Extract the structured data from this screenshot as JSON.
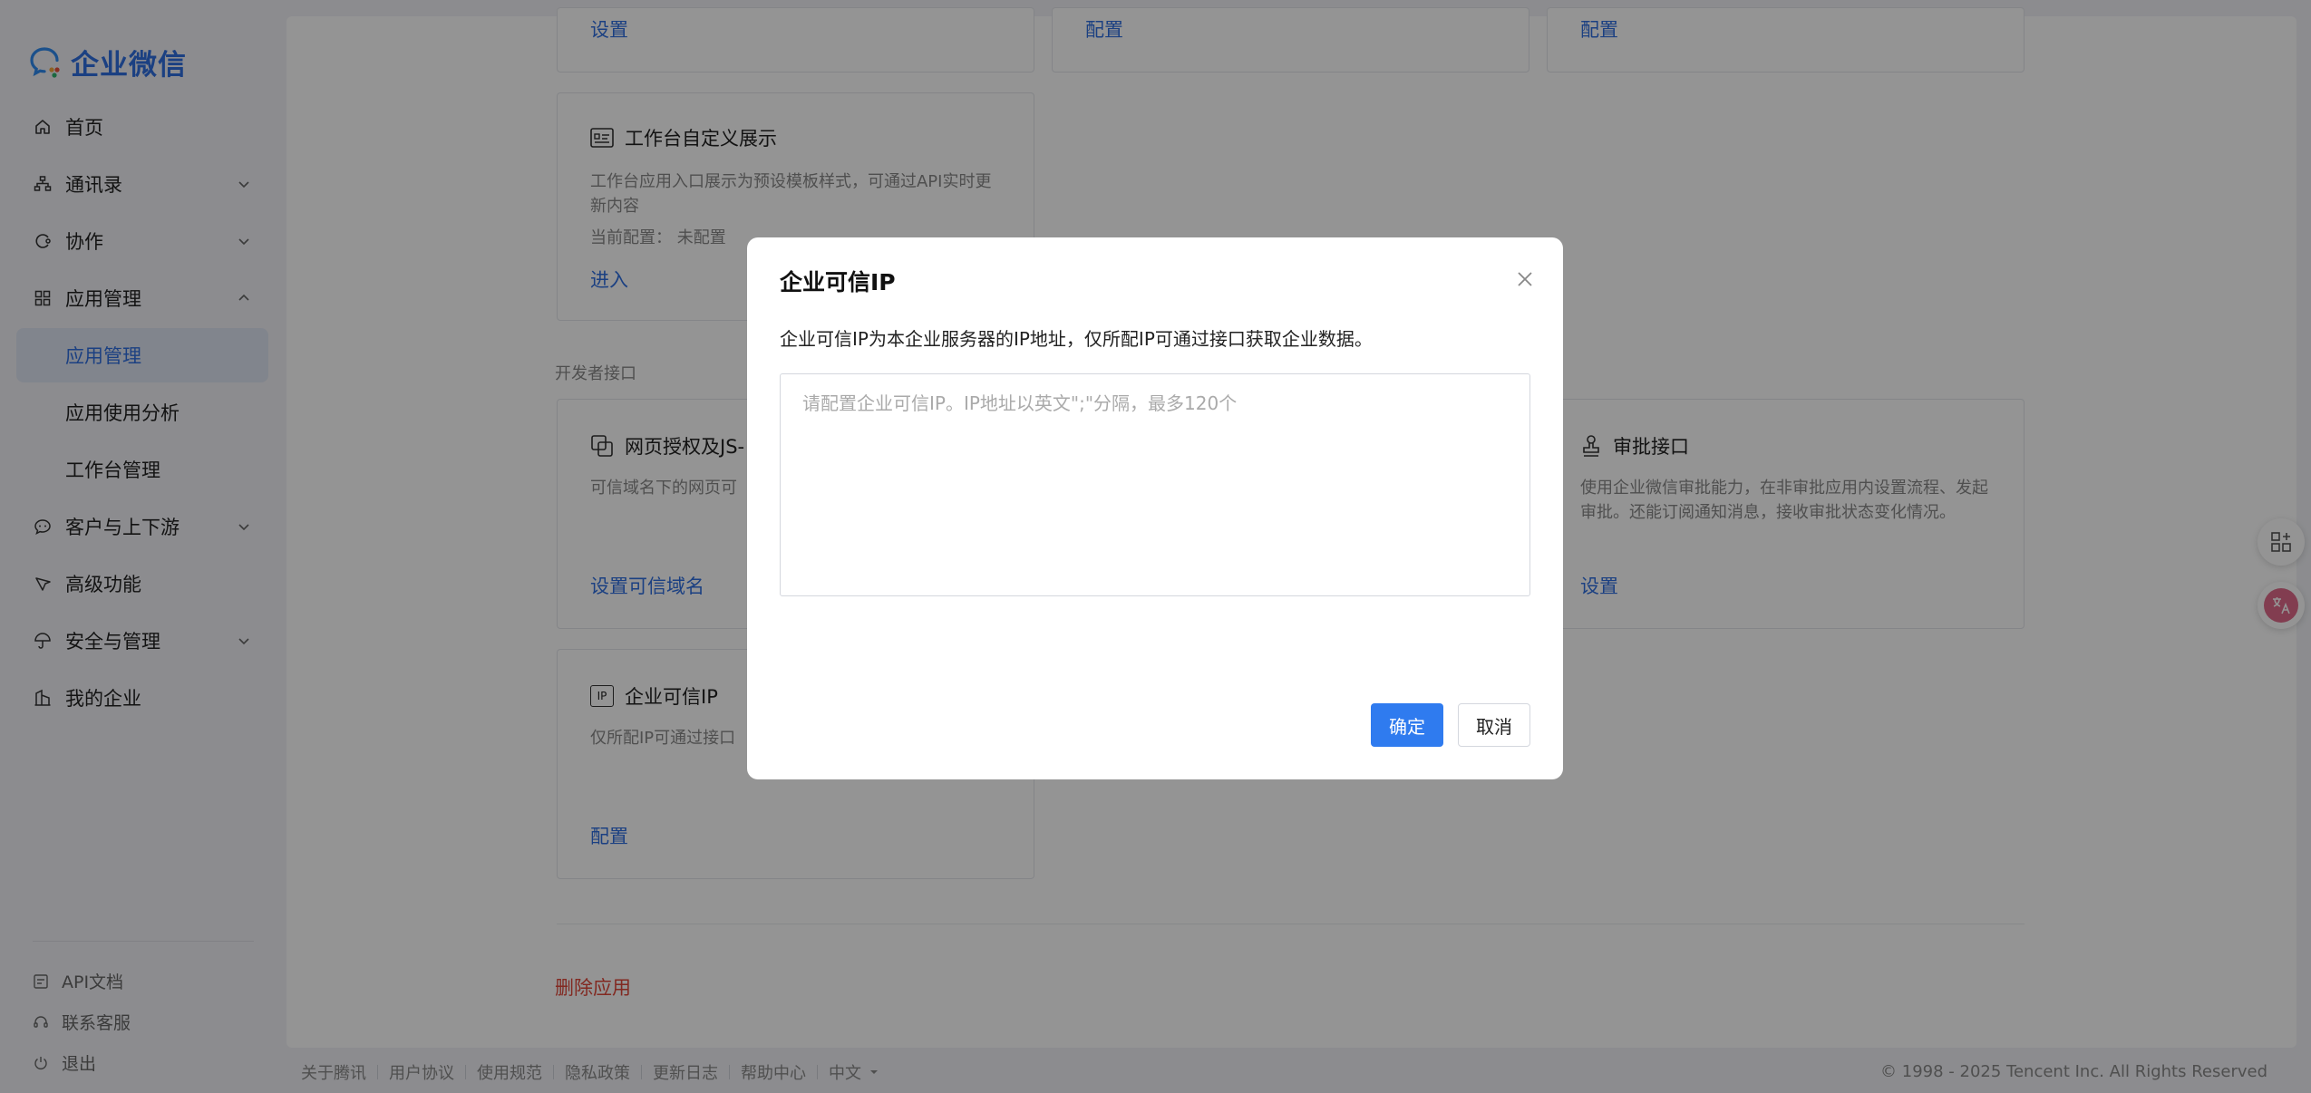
{
  "app": {
    "logo_text": "企业微信"
  },
  "sidebar": {
    "items": [
      {
        "label": "首页"
      },
      {
        "label": "通讯录"
      },
      {
        "label": "协作"
      },
      {
        "label": "应用管理"
      },
      {
        "label": "应用管理"
      },
      {
        "label": "应用使用分析"
      },
      {
        "label": "工作台管理"
      },
      {
        "label": "客户与上下游"
      },
      {
        "label": "高级功能"
      },
      {
        "label": "安全与管理"
      },
      {
        "label": "我的企业"
      }
    ],
    "bottom_links": [
      {
        "label": "API文档"
      },
      {
        "label": "联系客服"
      },
      {
        "label": "退出"
      }
    ]
  },
  "main": {
    "top_links": [
      "设置",
      "配置",
      "配置"
    ],
    "workbench_card": {
      "title": "工作台自定义展示",
      "desc": "工作台应用入口展示为预设模板样式，可通过API实时更新内容",
      "current_label": "当前配置：",
      "current_value": "未配置",
      "link": "进入"
    },
    "dev_section_label": "开发者接口",
    "web_auth_card": {
      "title": "网页授权及JS-",
      "desc": "可信域名下的网页可",
      "link": "设置可信域名"
    },
    "approval_card": {
      "title": "审批接口",
      "desc": "使用企业微信审批能力，在非审批应用内设置流程、发起审批。还能订阅通知消息，接收审批状态变化情况。",
      "link": "设置"
    },
    "trusted_ip_card": {
      "title": "企业可信IP",
      "icon_text": "IP",
      "desc": "仅所配IP可通过接口",
      "link": "配置"
    },
    "delete_link": "删除应用"
  },
  "footer": {
    "links": [
      "关于腾讯",
      "用户协议",
      "使用规范",
      "隐私政策",
      "更新日志",
      "帮助中心",
      "中文"
    ],
    "copyright": "© 1998 - 2025 Tencent Inc. All Rights Reserved"
  },
  "modal": {
    "title": "企业可信IP",
    "desc": "企业可信IP为本企业服务器的IP地址，仅所配IP可通过接口获取企业数据。",
    "textarea_placeholder": "请配置企业可信IP。IP地址以英文\";\"分隔，最多120个",
    "textarea_value": "",
    "confirm_label": "确定",
    "cancel_label": "取消"
  },
  "colors": {
    "accent": "#2f6fe0",
    "primary_button": "#2f7bef",
    "danger": "#e0473a"
  }
}
